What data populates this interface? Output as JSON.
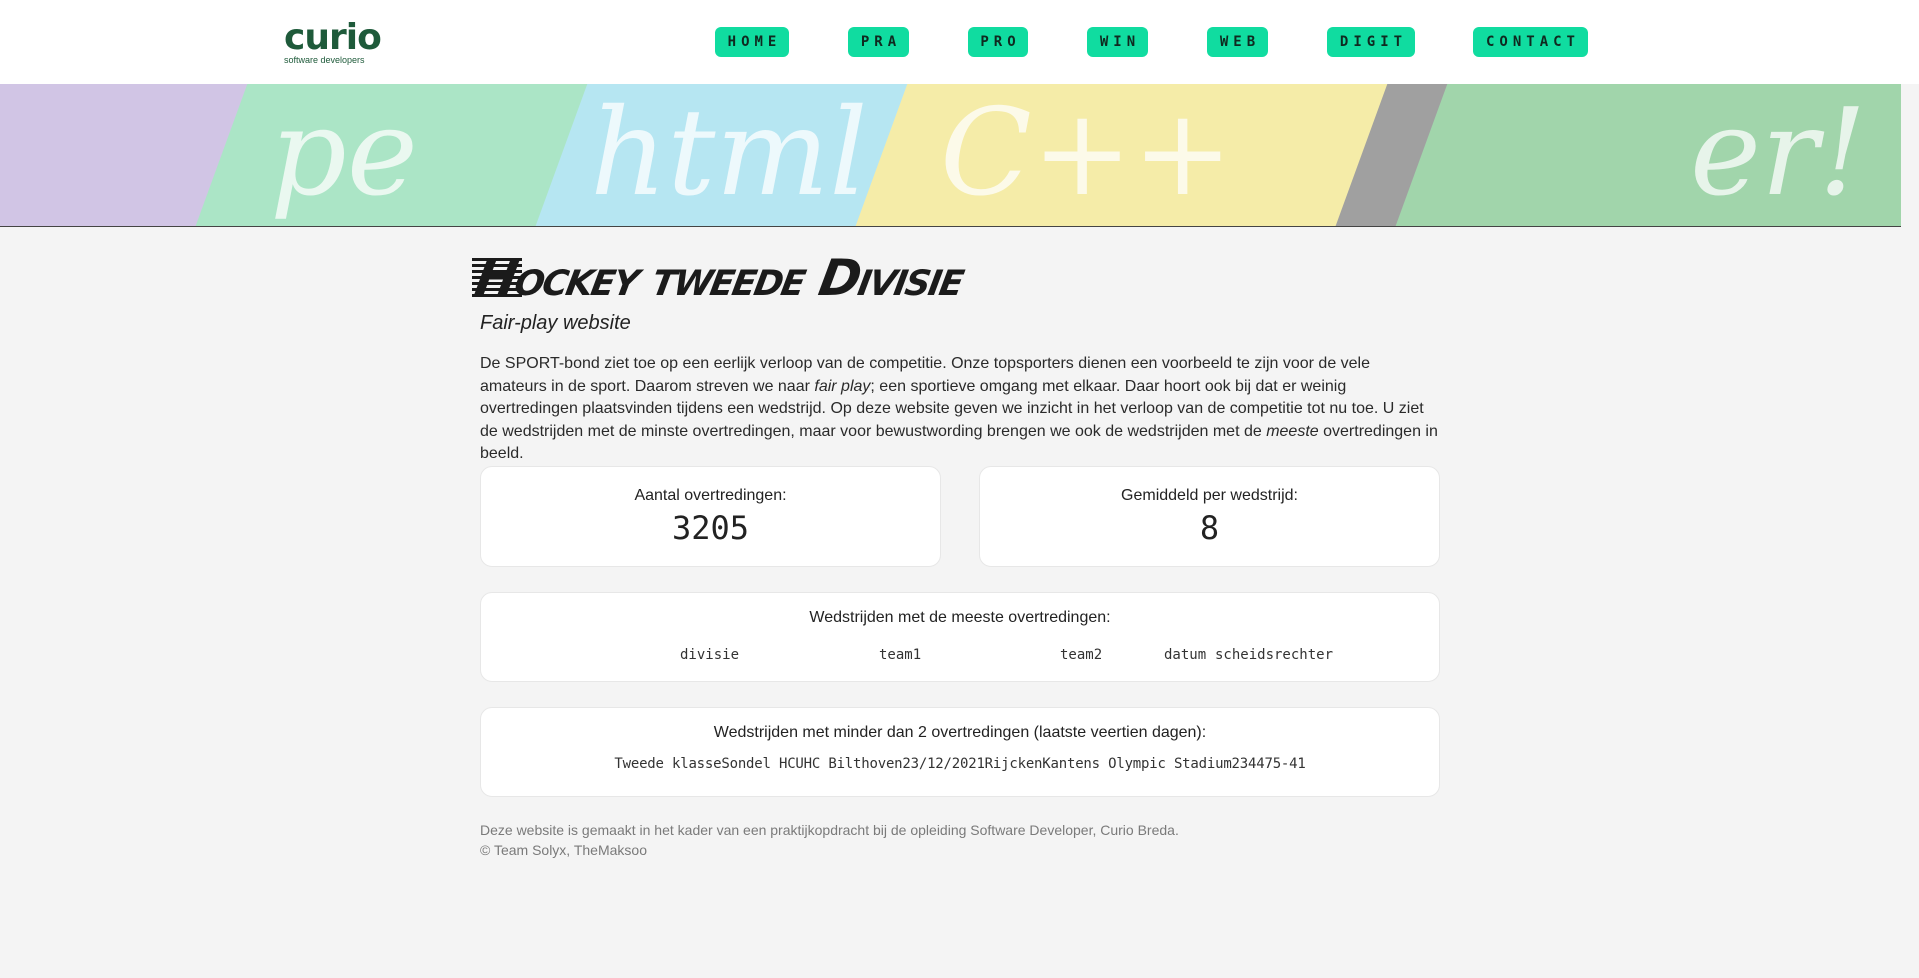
{
  "header": {
    "logo_text": "curio",
    "logo_subtext": "software developers",
    "nav": [
      {
        "label": "HOME"
      },
      {
        "label": "PRA"
      },
      {
        "label": "PRO"
      },
      {
        "label": "WIN"
      },
      {
        "label": "WEB"
      },
      {
        "label": "DIGIT"
      },
      {
        "label": "CONTACT"
      }
    ],
    "accent_color": "#10dca0"
  },
  "banner": {
    "words": [
      "pe",
      "html",
      "C++",
      "er!"
    ]
  },
  "main": {
    "title": "Hockey tweede Divisie",
    "subtitle": "Fair-play website",
    "intro_parts": [
      "De SPORT-bond ziet toe op een eerlijk verloop van de competitie. Onze topsporters dienen een voorbeeld te zijn voor de vele amateurs in de sport. Daarom streven we naar ",
      "fair play",
      "; een sportieve omgang met elkaar. Daar hoort ook bij dat er weinig overtredingen plaatsvinden tijdens een wedstrijd. Op deze website geven we inzicht in het verloop van de competitie tot nu toe. U ziet de wedstrijden met de minste overtredingen, maar voor bewustwording brengen we ook de wedstrijden met de ",
      "meeste",
      " overtredingen in beeld."
    ]
  },
  "stats": {
    "total_label": "Aantal overtredingen:",
    "total_value": "3205",
    "average_label": "Gemiddeld per wedstrijd:",
    "average_value": "8"
  },
  "most_violations": {
    "title": "Wedstrijden met de meeste overtredingen:",
    "columns": [
      "divisie",
      "team1",
      "team2",
      "datum",
      "scheidsrechter"
    ]
  },
  "least_violations": {
    "title": "Wedstrijden met minder dan 2 overtredingen (laatste veertien dagen):",
    "row": "Tweede klasseSondel HCUHC Bilthoven23/12/2021RijckenKantens Olympic Stadium234475-41"
  },
  "footer": {
    "line1": "Deze website is gemaakt in het kader van een praktijkopdracht bij de opleiding Software Developer, Curio Breda.",
    "line2": "© Team Solyx, TheMaksoo"
  }
}
